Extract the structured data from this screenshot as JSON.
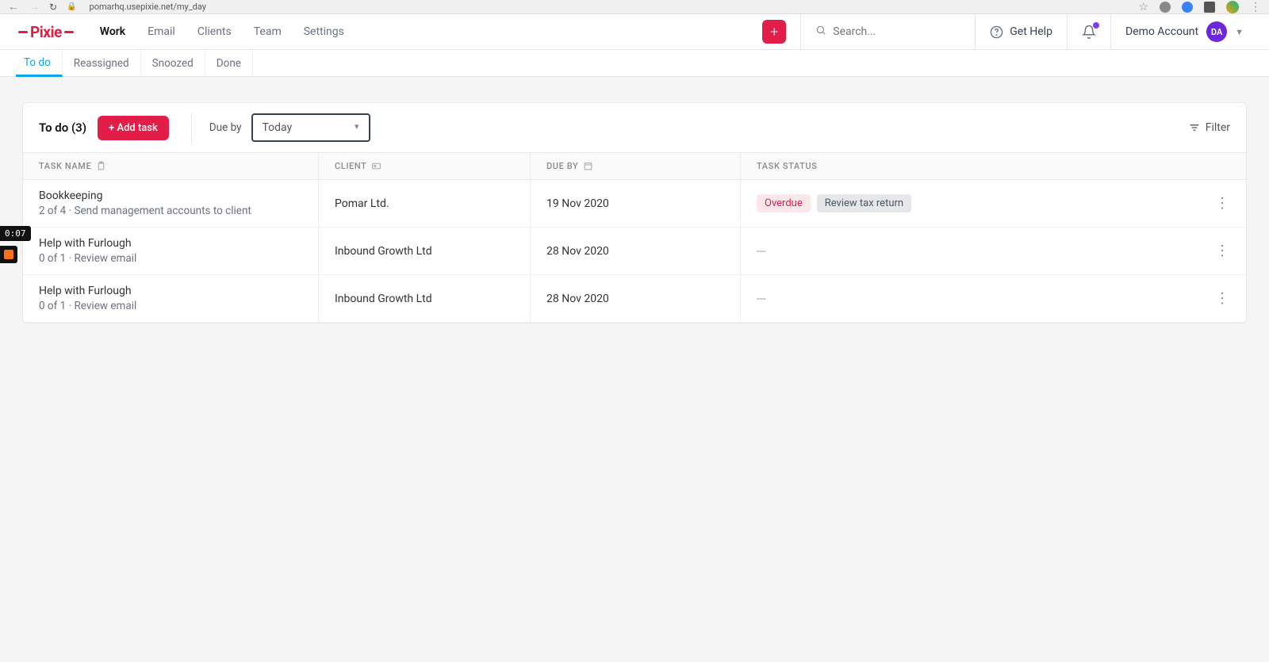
{
  "browser": {
    "url": "pomarhq.usepixie.net/my_day"
  },
  "brand": {
    "name": "Pixie"
  },
  "nav": {
    "items": [
      {
        "label": "Work",
        "active": true
      },
      {
        "label": "Email"
      },
      {
        "label": "Clients"
      },
      {
        "label": "Team"
      },
      {
        "label": "Settings"
      }
    ]
  },
  "header": {
    "search_placeholder": "Search...",
    "get_help_label": "Get Help",
    "account_name": "Demo Account",
    "account_initials": "DA"
  },
  "subnav": {
    "tabs": [
      {
        "label": "To do",
        "active": true
      },
      {
        "label": "Reassigned"
      },
      {
        "label": "Snoozed"
      },
      {
        "label": "Done"
      }
    ]
  },
  "panel": {
    "title": "To do (3)",
    "add_task_label": "+ Add task",
    "due_by_label": "Due by",
    "due_by_value": "Today",
    "filter_label": "Filter"
  },
  "columns": {
    "task": "TASK NAME",
    "client": "CLIENT",
    "due": "DUE BY",
    "status": "TASK STATUS"
  },
  "rows": [
    {
      "task_title": "Bookkeeping",
      "task_sub": "2 of 4 · Send management accounts to client",
      "client": "Pomar Ltd.",
      "due": "19 Nov 2020",
      "status_badges": [
        {
          "text": "Overdue",
          "kind": "overdue"
        },
        {
          "text": "Review tax return",
          "kind": "review"
        }
      ]
    },
    {
      "task_title": "Help with Furlough",
      "task_sub": "0 of 1 · Review email",
      "client": "Inbound Growth Ltd",
      "due": "28 Nov 2020",
      "status_text": "---"
    },
    {
      "task_title": "Help with Furlough",
      "task_sub": "0 of 1 · Review email",
      "client": "Inbound Growth Ltd",
      "due": "28 Nov 2020",
      "status_text": "---"
    }
  ],
  "recorder": {
    "time": "0:07"
  }
}
